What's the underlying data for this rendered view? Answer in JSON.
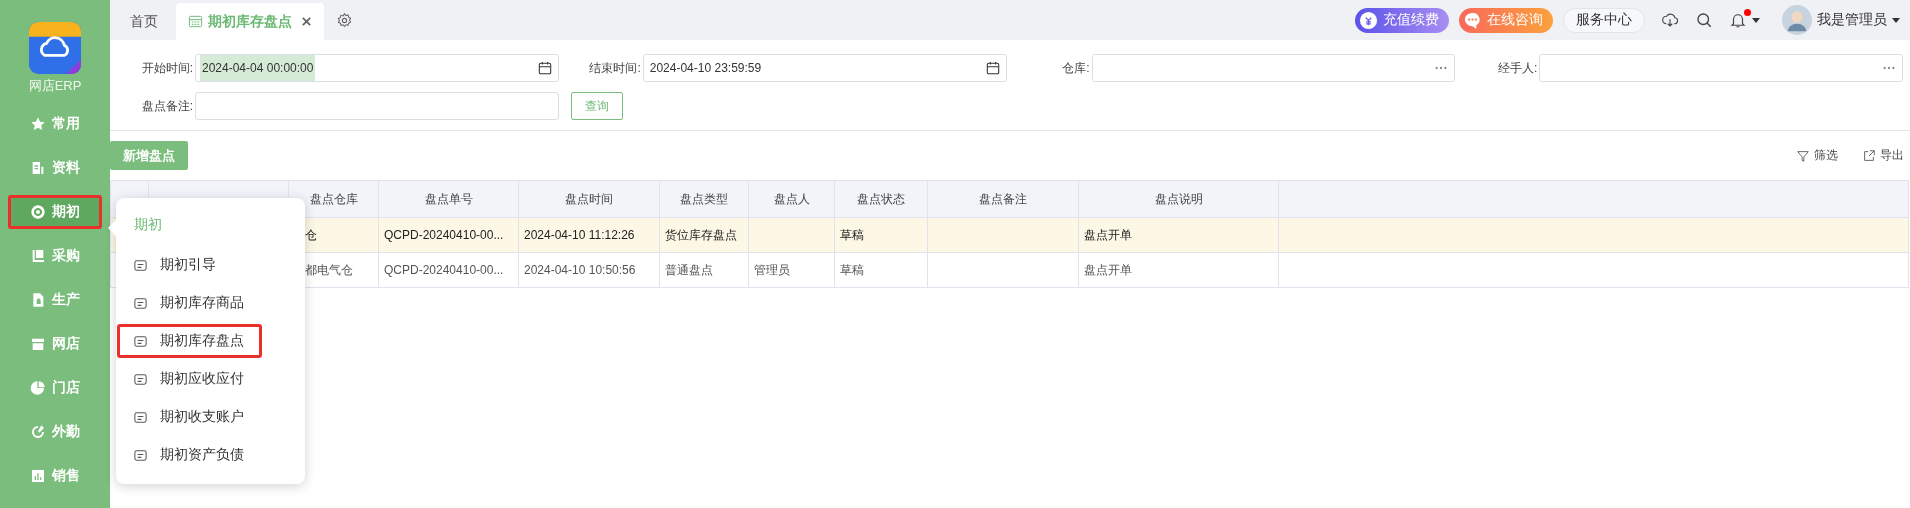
{
  "sidebar": {
    "logo_caption": "网店ERP",
    "items": [
      {
        "label": "常用",
        "selected": false
      },
      {
        "label": "资料",
        "selected": false
      },
      {
        "label": "期初",
        "selected": true
      },
      {
        "label": "采购",
        "selected": false
      },
      {
        "label": "生产",
        "selected": false
      },
      {
        "label": "网店",
        "selected": false
      },
      {
        "label": "门店",
        "selected": false
      },
      {
        "label": "外勤",
        "selected": false
      },
      {
        "label": "销售",
        "selected": false
      }
    ]
  },
  "tabs": [
    {
      "label": "首页",
      "selected": false
    },
    {
      "label": "期初库存盘点",
      "selected": true
    }
  ],
  "header_actions": {
    "recharge": "充值续费",
    "consult": "在线咨询",
    "service": "服务中心",
    "has_unread": true,
    "user": "我是管理员"
  },
  "filters": [
    {
      "label": "开始时间:",
      "kind": "date",
      "value": "2024-04-04 00:00:00",
      "value_selected": true
    },
    {
      "label": "结束时间:",
      "kind": "date",
      "value": "2024-04-10 23:59:59",
      "value_selected": false
    },
    {
      "label": "仓库:",
      "kind": "picker"
    },
    {
      "label": "经手人:",
      "kind": "picker"
    },
    {
      "label": "盘点备注:",
      "kind": "text"
    }
  ],
  "query_button": "查询",
  "toolbar": {
    "add_button": "新增盘点",
    "filter": "筛选",
    "export": "导出"
  },
  "table": {
    "columns": [
      "盘点仓库",
      "盘点单号",
      "盘点时间",
      "盘点类型",
      "盘点人",
      "盘点状态",
      "盘点备注",
      "盘点说明"
    ],
    "rows": [
      {
        "selected": true,
        "warehouse": "仓",
        "number": "QCPD-20240410-00...",
        "time": "2024-04-10 11:12:26",
        "type": "货位库存盘点",
        "status": "草稿",
        "description": "盘点开单"
      },
      {
        "selected": false,
        "warehouse": "都电气仓",
        "number": "QCPD-20240410-00...",
        "time": "2024-04-10 10:50:56",
        "type": "普通盘点",
        "counter": "管理员",
        "status": "草稿",
        "description": "盘点开单"
      }
    ]
  },
  "popup": {
    "title": "期初",
    "items": [
      {
        "label": "期初引导",
        "selected": false
      },
      {
        "label": "期初库存商品",
        "selected": false
      },
      {
        "label": "期初库存盘点",
        "selected": true
      },
      {
        "label": "期初应收应付",
        "selected": false
      },
      {
        "label": "期初收支账户",
        "selected": false
      },
      {
        "label": "期初资产负债",
        "selected": false
      }
    ]
  }
}
